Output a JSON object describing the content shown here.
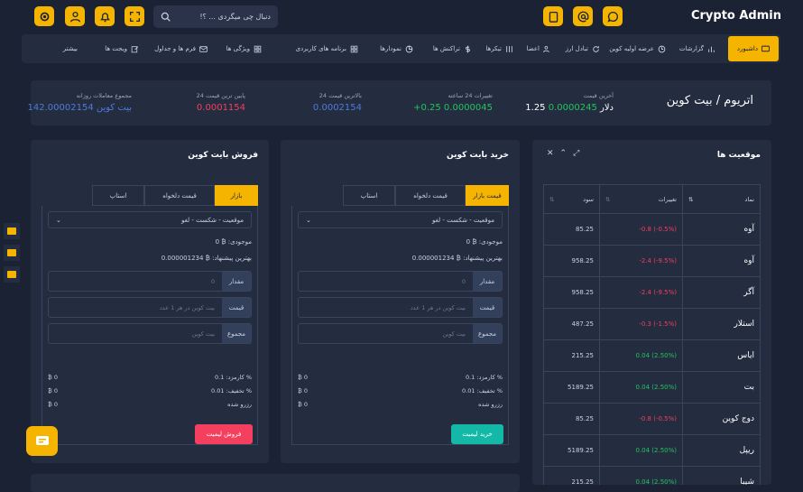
{
  "app": {
    "brand": "Crypto Admin",
    "search_placeholder": "دنبال چی میگردی ... ؟!"
  },
  "nav": [
    {
      "label": "داشبورد",
      "icon": "monitor-icon",
      "active": true
    },
    {
      "label": "گزارشات",
      "icon": "chart-icon"
    },
    {
      "label": "عرضه اولیه کوین",
      "icon": "clock-icon"
    },
    {
      "label": "تبادل ارز",
      "icon": "refresh-icon"
    },
    {
      "label": "اعضا",
      "icon": "users-icon"
    },
    {
      "label": "تیکرها",
      "icon": "sliders-icon"
    },
    {
      "label": "تراکنش ها",
      "icon": "dollar-icon"
    },
    {
      "label": "نمودارها",
      "icon": "chart-pie-icon"
    },
    {
      "label": "برنامه های کاربردی",
      "icon": "grid-icon"
    },
    {
      "label": "ویژگی ها",
      "icon": "grid-icon"
    },
    {
      "label": "فرم ها و جداول",
      "icon": "mail-icon"
    },
    {
      "label": "ویجت ها",
      "icon": "edit-icon"
    },
    {
      "label": "بیشتر",
      "icon": ""
    }
  ],
  "ticker": {
    "pair": "اتریوم / بیت کوین",
    "last_price_label": "آخرین قیمت",
    "last_price": "0.0000245",
    "last_price_usd": "1.25 دلار",
    "change_label": "تغییرات 24 ساعته",
    "change": "0.0000045",
    "change_pct": "+0.25",
    "high_label": "بالاترین قیمت 24",
    "high": "0.0002154",
    "low_label": "پایین ترین قیمت 24",
    "low": "0.0001154",
    "volume_label": "مجموع معاملات روزانه",
    "volume": "142.00002154 بیت کوین"
  },
  "buy": {
    "title": "خرید بایت کوین",
    "tabs": [
      "قیمت بازار",
      "قیمت دلخواه",
      "استاپ"
    ],
    "select": "موقعیت - شکست - لغو",
    "balance": "موجودی: ₿ 0",
    "best": "بهترین پیشنهاد: ₿ 0.000001234",
    "amount_label": "مقدار",
    "amount_ph": "0",
    "price_label": "قیمت",
    "price_ph": "بیت کوین در هر 1 عدد",
    "total_label": "مجموع",
    "total_ph": "بیت کوین",
    "fee": "کارمزد: 0.1 %",
    "fee_val": "₿ 0",
    "discount": "تخفیف: 0.01 %",
    "discount_val": "₿ 0",
    "reserved": "رزرو شده",
    "reserved_val": "₿ 0",
    "button": "خرید لیمیت"
  },
  "sell": {
    "title": "فروش بایت کوین",
    "tabs": [
      "بازار",
      "قیمت دلخواه",
      "استاپ"
    ],
    "select": "موقعیت - شکست - لغو",
    "balance": "موجودی: ₿ 0",
    "best": "بهترین پیشنهاد: ₿ 0.000001234",
    "amount_label": "مقدار",
    "amount_ph": "0",
    "price_label": "قیمت",
    "price_ph": "بیت کوین در هر 1 عدد",
    "total_label": "مجموع",
    "total_ph": "بیت کوین",
    "fee": "کارمزد: 0.1 %",
    "fee_val": "₿ 0",
    "discount": "تخفیف: 0.01 %",
    "discount_val": "₿ 0",
    "reserved": "رزرو شده",
    "reserved_val": "₿ 0",
    "button": "فروش لیمیت"
  },
  "positions": {
    "title": "موقعیت ها",
    "headers": [
      "نماد",
      "تغییرات",
      "سود"
    ],
    "rows": [
      {
        "symbol": "آوه",
        "change": "-0.8 (-0.5%)",
        "profit": "85.25",
        "up": false
      },
      {
        "symbol": "آوه",
        "change": "-2.4 (-9.5%)",
        "profit": "958.25",
        "up": false
      },
      {
        "symbol": "آگر",
        "change": "-2.4 (-9.5%)",
        "profit": "958.25",
        "up": false
      },
      {
        "symbol": "استلار",
        "change": "-0.3 (-1.5%)",
        "profit": "487.25",
        "up": false
      },
      {
        "symbol": "ایاس",
        "change": "0.04 (2.50%)",
        "profit": "215.25",
        "up": true
      },
      {
        "symbol": "بت",
        "change": "0.04 (2.50%)",
        "profit": "5189.25",
        "up": true
      },
      {
        "symbol": "دوج کوین",
        "change": "-0.8 (-0.5%)",
        "profit": "85.25",
        "up": false
      },
      {
        "symbol": "ریپل",
        "change": "0.04 (2.50%)",
        "profit": "5189.25",
        "up": true
      },
      {
        "symbol": "شیبا",
        "change": "0.04 (2.50%)",
        "profit": "215.25",
        "up": true
      }
    ]
  },
  "colors": {
    "accent": "#f4b400",
    "green": "#22c55e",
    "red": "#f43f5e",
    "buy": "#14b8a6",
    "sell": "#f43f5e",
    "blue": "#4f7bd9"
  }
}
